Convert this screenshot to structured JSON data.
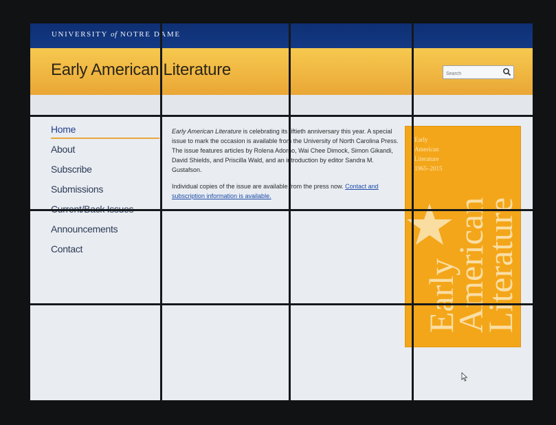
{
  "header": {
    "university_prefix": "UNIVERSITY",
    "university_of": "of",
    "university_suffix": "NOTRE DAME",
    "site_title": "Early American Literature",
    "search_placeholder": "Search"
  },
  "nav": {
    "items": [
      {
        "label": "Home"
      },
      {
        "label": "About"
      },
      {
        "label": "Subscribe"
      },
      {
        "label": "Submissions"
      },
      {
        "label": "Current/Back Issues"
      },
      {
        "label": "Announcements"
      },
      {
        "label": "Contact"
      }
    ]
  },
  "content": {
    "p1_em": "Early American Literature",
    "p1_rest": " is celebrating its fiftieth anniversary this year. A special issue to mark the occasion is available from the University of North Carolina Press. The issue features articles by Rolena Adorno, Wai Chee Dimock, Simon Gikandi, David Shields, and Priscilla Wald, and an introduction by editor Sandra M. Gustafson.",
    "p2_text": "Individual copies of the issue are available from the press now. ",
    "p2_link": "Contact and subscription information is available."
  },
  "cover": {
    "line1": "Early",
    "line2": "American",
    "line3": "Literature",
    "years": "1965–2015",
    "big1": "Early",
    "big2": "American",
    "big3": "Literature"
  },
  "colors": {
    "topbar": "#0e2f72",
    "banner": "#eaa735",
    "cover": "#f3a619",
    "accent_rule": "#e8a63a",
    "link": "#1c4aa6"
  }
}
